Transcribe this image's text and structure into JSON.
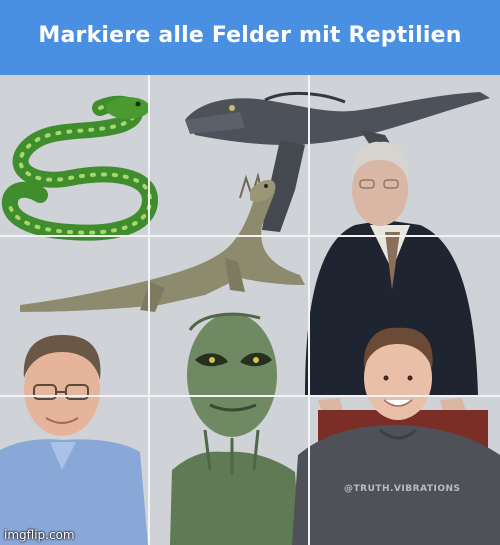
{
  "header": {
    "title": "Markiere alle Felder mit Reptilien"
  },
  "tiles": [
    {
      "row": 1,
      "col": 1
    },
    {
      "row": 1,
      "col": 2
    },
    {
      "row": 1,
      "col": 3
    },
    {
      "row": 2,
      "col": 1
    },
    {
      "row": 2,
      "col": 2
    },
    {
      "row": 2,
      "col": 3
    },
    {
      "row": 3,
      "col": 1
    },
    {
      "row": 3,
      "col": 2
    },
    {
      "row": 3,
      "col": 3
    }
  ],
  "watermark_text": "@TRUTH.VIBRATIONS",
  "imgflip_text": "imgflip.com",
  "colors": {
    "header_blue": "#4a90e2",
    "background": "#d4d6d9",
    "gridline": "#f2f3f5"
  }
}
